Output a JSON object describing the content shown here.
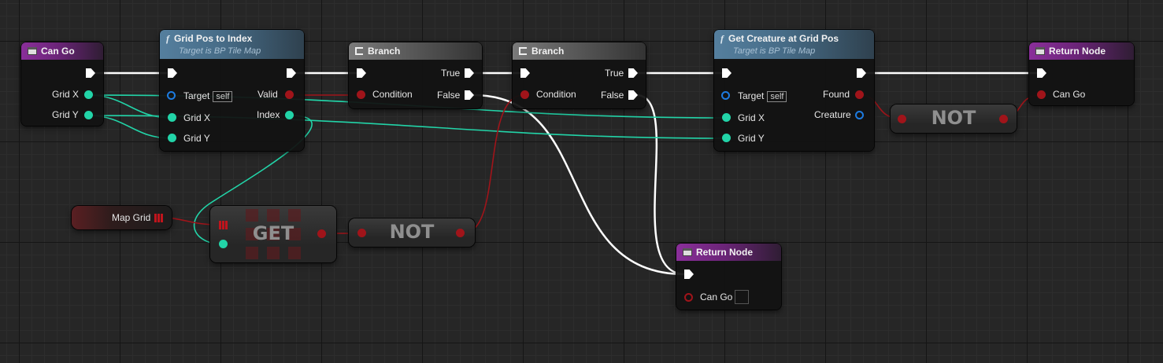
{
  "graph": {
    "can_go": {
      "title": "Can Go",
      "pin_x": "Grid X",
      "pin_y": "Grid Y"
    },
    "grid_pos_to_index": {
      "title": "Grid Pos to Index",
      "subtitle": "Target is BP Tile Map",
      "target": "Target",
      "self": "self",
      "grid_x": "Grid X",
      "grid_y": "Grid Y",
      "valid": "Valid",
      "index": "Index"
    },
    "branch_1": {
      "title": "Branch",
      "condition": "Condition",
      "true_pin": "True",
      "false_pin": "False"
    },
    "branch_2": {
      "title": "Branch",
      "condition": "Condition",
      "true_pin": "True",
      "false_pin": "False"
    },
    "get_creature": {
      "title": "Get Creature at Grid Pos",
      "subtitle": "Target is BP Tile Map",
      "target": "Target",
      "self": "self",
      "grid_x": "Grid X",
      "grid_y": "Grid Y",
      "found": "Found",
      "creature": "Creature"
    },
    "return_top": {
      "title": "Return Node",
      "can_go": "Can Go"
    },
    "not_top": {
      "label": "NOT"
    },
    "map_grid": {
      "label": "Map Grid"
    },
    "get_node": {
      "label": "GET"
    },
    "not_mid": {
      "label": "NOT"
    },
    "return_bottom": {
      "title": "Return Node",
      "can_go": "Can Go"
    }
  },
  "colors": {
    "exec_wire": "#ffffff",
    "int_wire": "#22d4a8",
    "bool_wire": "#a0141a",
    "object_pin": "#1d7be0",
    "event_header": "#8a2f9a",
    "function_header": "#557f9e"
  }
}
